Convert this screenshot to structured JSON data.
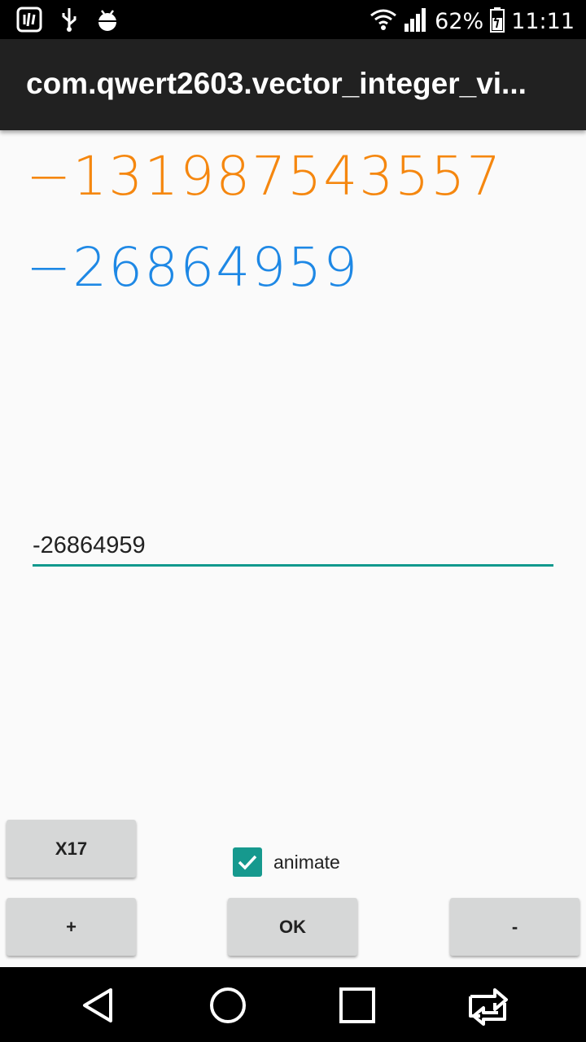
{
  "status_bar": {
    "battery_percent": "62%",
    "time": "11:11",
    "icons": [
      "notification-icon",
      "usb-icon",
      "android-debug-icon",
      "wifi-icon",
      "signal-icon",
      "battery-icon"
    ]
  },
  "app_bar": {
    "title": "com.qwert2603.vector_integer_vi..."
  },
  "display": {
    "number_orange": "−131987543557",
    "number_blue": "−26864959",
    "color_orange": "#f5870f",
    "color_blue": "#1e88e5"
  },
  "input": {
    "value": "-26864959",
    "underline_color": "#11998e"
  },
  "buttons": {
    "x17_label": "X17",
    "plus_label": "+",
    "ok_label": "OK",
    "minus_label": "-"
  },
  "checkbox": {
    "label": "animate",
    "checked": true
  },
  "nav_bar": {
    "icons": [
      "back-icon",
      "home-icon",
      "recents-icon",
      "switch-app-icon"
    ]
  }
}
